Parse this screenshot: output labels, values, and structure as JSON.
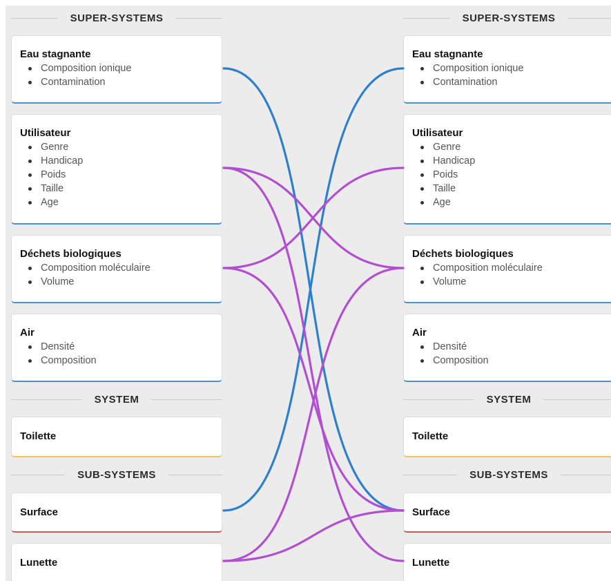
{
  "columns": {
    "left": {
      "super_header": "SUPER-SYSTEMS",
      "system_header": "SYSTEM",
      "sub_header": "SUB-SYSTEMS",
      "super_systems": [
        {
          "title": "Eau stagnante",
          "attributes": [
            "Composition ionique",
            "Contamination"
          ]
        },
        {
          "title": "Utilisateur",
          "attributes": [
            "Genre",
            "Handicap",
            "Poids",
            "Taille",
            "Age"
          ]
        },
        {
          "title": "Déchets biologiques",
          "attributes": [
            "Composition moléculaire",
            "Volume"
          ]
        },
        {
          "title": "Air",
          "attributes": [
            "Densité",
            "Composition"
          ]
        }
      ],
      "system": {
        "title": "Toilette"
      },
      "sub_systems": [
        {
          "title": "Surface"
        },
        {
          "title": "Lunette"
        }
      ]
    },
    "right": {
      "super_header": "SUPER-SYSTEMS",
      "system_header": "SYSTEM",
      "sub_header": "SUB-SYSTEMS",
      "super_systems": [
        {
          "title": "Eau stagnante",
          "attributes": [
            "Composition ionique",
            "Contamination"
          ]
        },
        {
          "title": "Utilisateur",
          "attributes": [
            "Genre",
            "Handicap",
            "Poids",
            "Taille",
            "Age"
          ]
        },
        {
          "title": "Déchets biologiques",
          "attributes": [
            "Composition moléculaire",
            "Volume"
          ]
        },
        {
          "title": "Air",
          "attributes": [
            "Densité",
            "Composition"
          ]
        }
      ],
      "system": {
        "title": "Toilette"
      },
      "sub_systems": [
        {
          "title": "Surface"
        },
        {
          "title": "Lunette"
        }
      ]
    }
  },
  "colors": {
    "blue_arrow": "#2f80cc",
    "purple_arrow": "#b24fd0",
    "super_border": "#4a8fd6",
    "system_border": "#f0c64e",
    "sub_border": "#d9534f"
  },
  "arrows": [
    {
      "from": "Eau stagnante",
      "to": "Surface",
      "color": "blue"
    },
    {
      "from": "Surface",
      "to": "Eau stagnante",
      "color": "blue"
    },
    {
      "from": "Utilisateur",
      "to": "Déchets biologiques",
      "color": "purple"
    },
    {
      "from": "Utilisateur",
      "to": "Lunette",
      "color": "purple"
    },
    {
      "from": "Déchets biologiques",
      "to": "Utilisateur",
      "color": "purple"
    },
    {
      "from": "Déchets biologiques",
      "to": "Surface",
      "color": "purple"
    },
    {
      "from": "Lunette",
      "to": "Déchets biologiques",
      "color": "purple"
    },
    {
      "from": "Lunette",
      "to": "Surface",
      "color": "purple"
    }
  ]
}
